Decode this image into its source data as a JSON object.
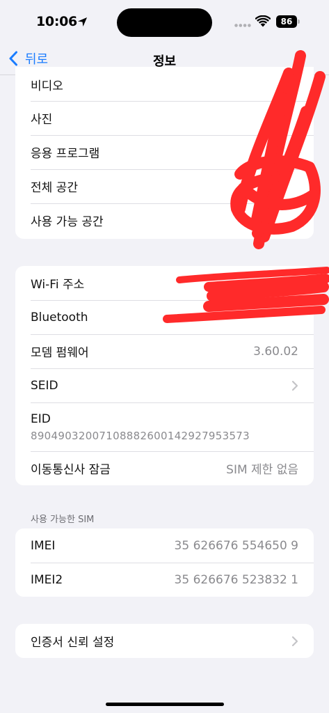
{
  "status_bar": {
    "time": "10:06",
    "battery": "86"
  },
  "nav": {
    "back_label": "뒤로",
    "title": "정보"
  },
  "storage": {
    "rows": [
      {
        "label": "비디오",
        "value": ""
      },
      {
        "label": "사진",
        "value": ""
      },
      {
        "label": "응용 프로그램",
        "value": ""
      },
      {
        "label": "전체 공간",
        "value": ""
      },
      {
        "label": "사용 가능 공간",
        "value": ""
      }
    ]
  },
  "network": {
    "wifi_label": "Wi-Fi 주소",
    "bluetooth_label": "Bluetooth",
    "modem_label": "모뎀 펌웨어",
    "modem_value": "3.60.02",
    "seid_label": "SEID",
    "eid_label": "EID",
    "eid_value": "89049032007108882600142927953573",
    "carrier_lock_label": "이동통신사 잠금",
    "carrier_lock_value": "SIM 제한 없음"
  },
  "sim": {
    "header": "사용 가능한 SIM",
    "imei_label": "IMEI",
    "imei_value": "35 626676 554650 9",
    "imei2_label": "IMEI2",
    "imei2_value": "35 626676 523832 1"
  },
  "certificate": {
    "label": "인증서 신뢰 설정"
  },
  "colors": {
    "accent": "#1a7cff",
    "background": "#f2f2f7",
    "scribble": "#ff2a2a"
  },
  "icons": {
    "back": "chevron-left-icon",
    "disclosure": "chevron-right-icon",
    "location": "location-arrow-icon",
    "wifi": "wifi-icon",
    "signal": "cellular-signal-icon",
    "battery": "battery-icon"
  }
}
